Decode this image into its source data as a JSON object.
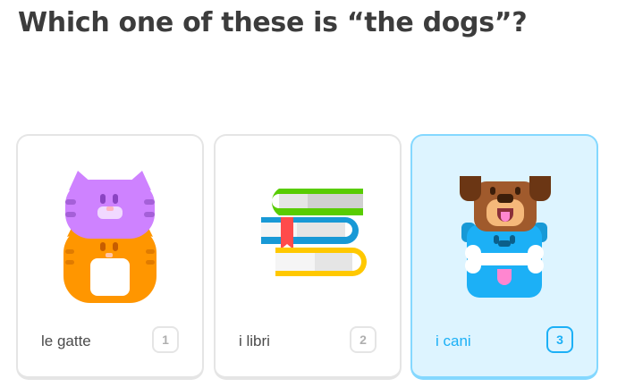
{
  "question": {
    "text": "Which one of these is “the dogs”?"
  },
  "options": [
    {
      "label": "le gatte",
      "key": "1",
      "selected": false,
      "art": "cats-illustration"
    },
    {
      "label": "i libri",
      "key": "2",
      "selected": false,
      "art": "books-illustration"
    },
    {
      "label": "i cani",
      "key": "3",
      "selected": true,
      "art": "dogs-illustration"
    }
  ],
  "colors": {
    "selected_border": "#84d8ff",
    "selected_background": "#ddf4ff",
    "selected_text": "#1cb0f6",
    "card_border": "#e5e5e5",
    "title_text": "#3c3c3c"
  }
}
